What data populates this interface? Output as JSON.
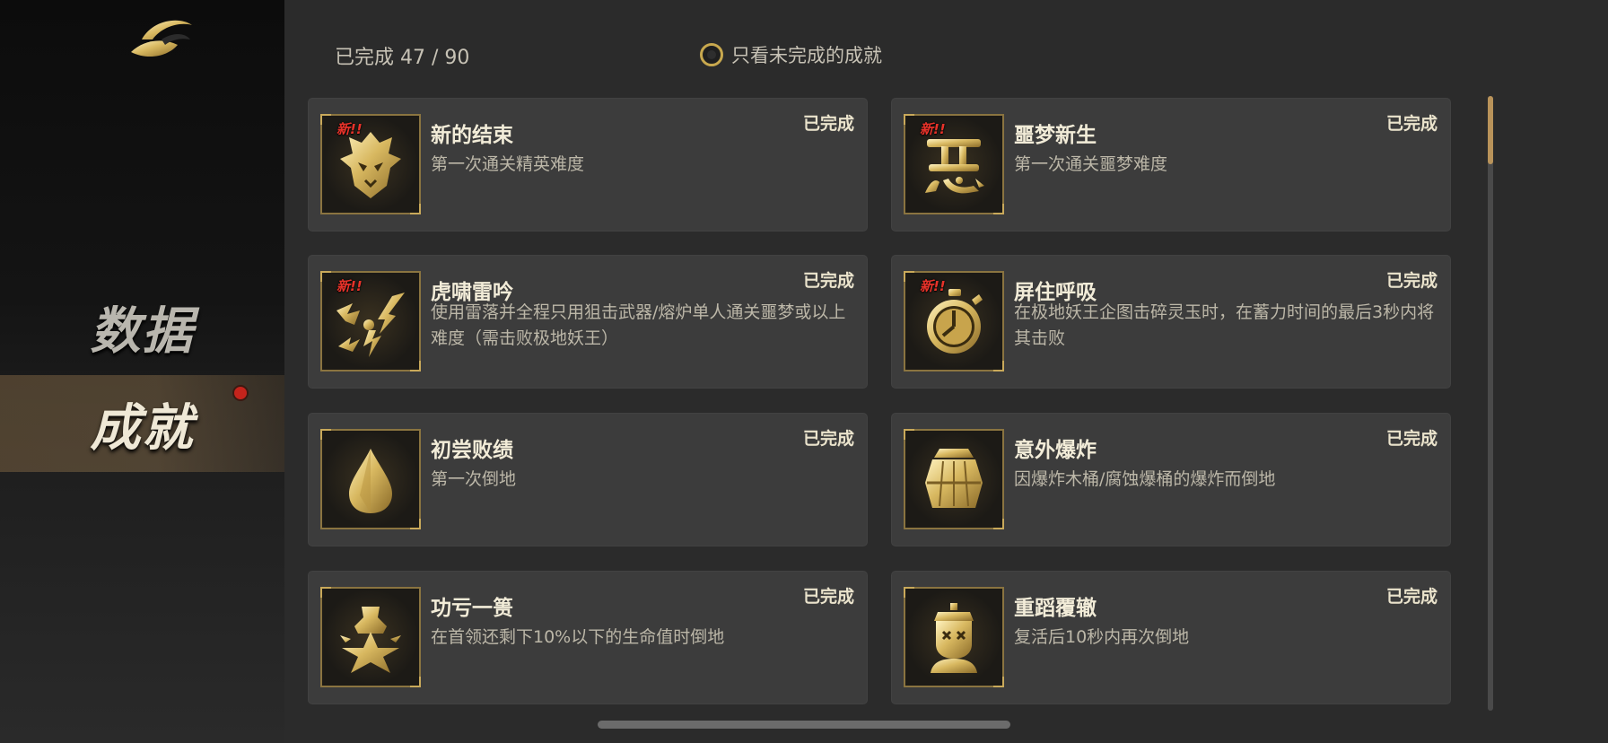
{
  "sidebar": {
    "logo": "logo-icon",
    "items": [
      {
        "label": "数据",
        "active": false
      },
      {
        "label": "成就",
        "active": true,
        "has_notification": true
      }
    ]
  },
  "header": {
    "progress": "已完成 47 / 90",
    "filter_label": "只看未完成的成就",
    "filter_checked": false
  },
  "colors": {
    "accent_gold": "#c8a84e",
    "card_bg": "#3c3c3c",
    "active_tab": "#786040",
    "notification_red": "#c4241c",
    "new_badge_red": "#e8332a"
  },
  "achievements": [
    {
      "title": "新的结束",
      "desc": "第一次通关精英难度",
      "status": "已完成",
      "badge": "新!!",
      "icon": "mask-icon"
    },
    {
      "title": "噩梦新生",
      "desc": "第一次通关噩梦难度",
      "status": "已完成",
      "badge": "新!!",
      "icon": "evil-glyph-icon"
    },
    {
      "title": "虎啸雷吟",
      "desc": "使用雷落并全程只用狙击武器/熔炉单人通关噩梦或以上难度（需击败极地妖王）",
      "status": "已完成",
      "badge": "新!!",
      "icon": "lightning-icon"
    },
    {
      "title": "屏住呼吸",
      "desc": "在极地妖王企图击碎灵玉时，在蓄力时间的最后3秒内将其击败",
      "status": "已完成",
      "badge": "新!!",
      "icon": "stopwatch-icon"
    },
    {
      "title": "初尝败绩",
      "desc": "第一次倒地",
      "status": "已完成",
      "badge": "",
      "icon": "drop-icon"
    },
    {
      "title": "意外爆炸",
      "desc": "因爆炸木桶/腐蚀爆桶的爆炸而倒地",
      "status": "已完成",
      "badge": "",
      "icon": "barrel-icon"
    },
    {
      "title": "功亏一篑",
      "desc": "在首领还剩下10%以下的生命值时倒地",
      "status": "已完成",
      "badge": "",
      "icon": "broken-vase-icon"
    },
    {
      "title": "重蹈覆辙",
      "desc": "复活后10秒内再次倒地",
      "status": "已完成",
      "badge": "",
      "icon": "dead-character-icon"
    }
  ]
}
